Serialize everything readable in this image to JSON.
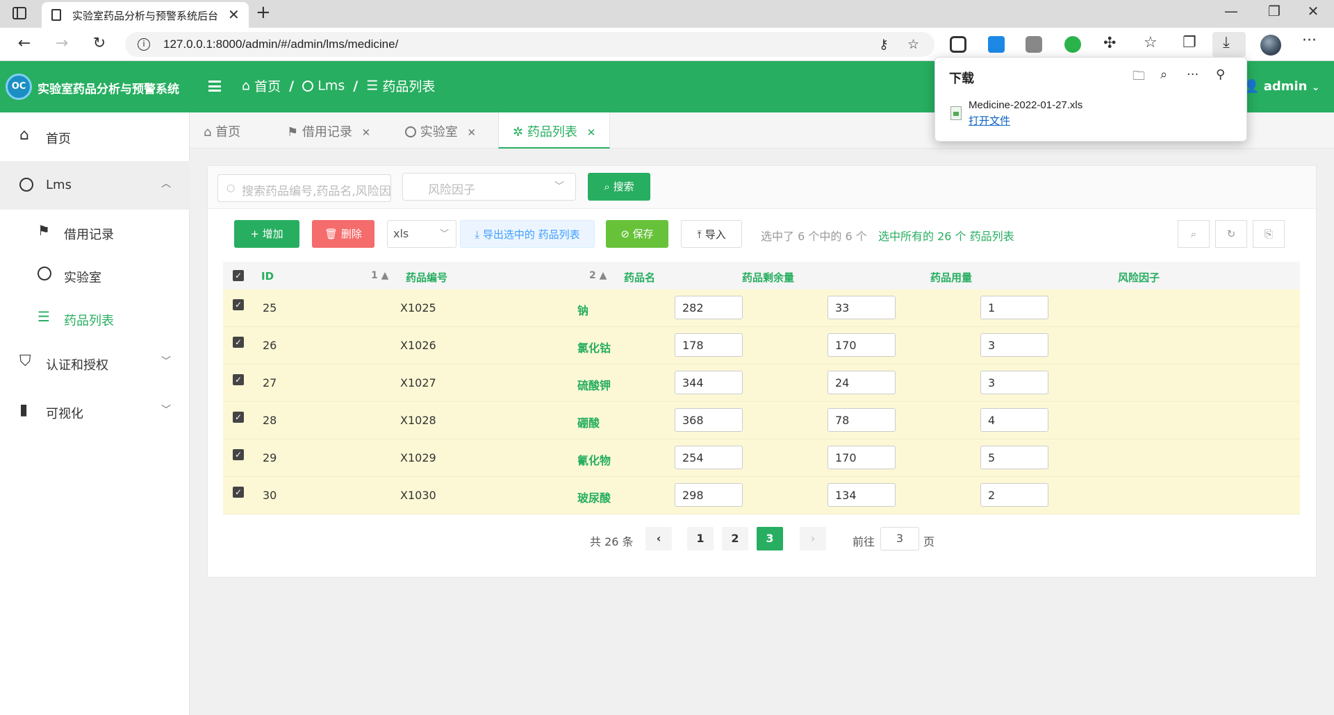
{
  "browser": {
    "tab_title": "实验室药品分析与预警系统后台",
    "tab_close": "✕",
    "new_tab": "+",
    "url": "127.0.0.1:8000/admin/#/admin/lms/medicine/",
    "window_controls": [
      "—",
      "❐",
      "✕"
    ]
  },
  "downloads": {
    "title": "下载",
    "filename": "Medicine-2022-01-27.xls",
    "open_label": "打开文件"
  },
  "app": {
    "logo_text": "OC",
    "title": "实验室药品分析与预警系统",
    "breadcrumb": [
      "首页",
      "Lms",
      "药品列表"
    ],
    "user": "admin"
  },
  "sidebar": {
    "items": [
      {
        "label": "首页"
      },
      {
        "label": "Lms",
        "children": [
          {
            "label": "借用记录"
          },
          {
            "label": "实验室"
          },
          {
            "label": "药品列表"
          }
        ]
      },
      {
        "label": "认证和授权"
      },
      {
        "label": "可视化"
      }
    ]
  },
  "tabs": [
    {
      "label": "首页"
    },
    {
      "label": "借用记录"
    },
    {
      "label": "实验室"
    },
    {
      "label": "药品列表"
    }
  ],
  "filters": {
    "search_placeholder": "搜索药品编号,药品名,风险因子",
    "risk_placeholder": "风险因子",
    "search_button": "搜索"
  },
  "toolbar": {
    "add": "增加",
    "delete": "删除",
    "format": "xls",
    "export": "导出选中的 药品列表",
    "save": "保存",
    "import": "导入",
    "selected_info": "选中了 6 个中的 6 个",
    "select_all": "选中所有的 26 个 药品列表"
  },
  "table": {
    "columns": [
      "ID",
      "药品编号",
      "药品名",
      "药品剩余量",
      "药品用量",
      "风险因子"
    ],
    "sort_id": "1 ▲",
    "sort_code": "2 ▲",
    "rows": [
      {
        "id": "25",
        "code": "X1025",
        "name": "钠",
        "remaining": "282",
        "usage": "33",
        "risk": "1"
      },
      {
        "id": "26",
        "code": "X1026",
        "name": "氯化钴",
        "remaining": "178",
        "usage": "170",
        "risk": "3"
      },
      {
        "id": "27",
        "code": "X1027",
        "name": "硫酸钾",
        "remaining": "344",
        "usage": "24",
        "risk": "3"
      },
      {
        "id": "28",
        "code": "X1028",
        "name": "硼酸",
        "remaining": "368",
        "usage": "78",
        "risk": "4"
      },
      {
        "id": "29",
        "code": "X1029",
        "name": "氰化物",
        "remaining": "254",
        "usage": "170",
        "risk": "5"
      },
      {
        "id": "30",
        "code": "X1030",
        "name": "玻尿酸",
        "remaining": "298",
        "usage": "134",
        "risk": "2"
      }
    ]
  },
  "pager": {
    "total": "共 26 条",
    "pages": [
      "1",
      "2",
      "3"
    ],
    "current": "3",
    "goto_label": "前往",
    "goto_value": "3",
    "unit": "页"
  },
  "colors": {
    "primary": "#27ae60",
    "danger": "#f56c6c",
    "row_highlight": "#fcf8d5"
  }
}
